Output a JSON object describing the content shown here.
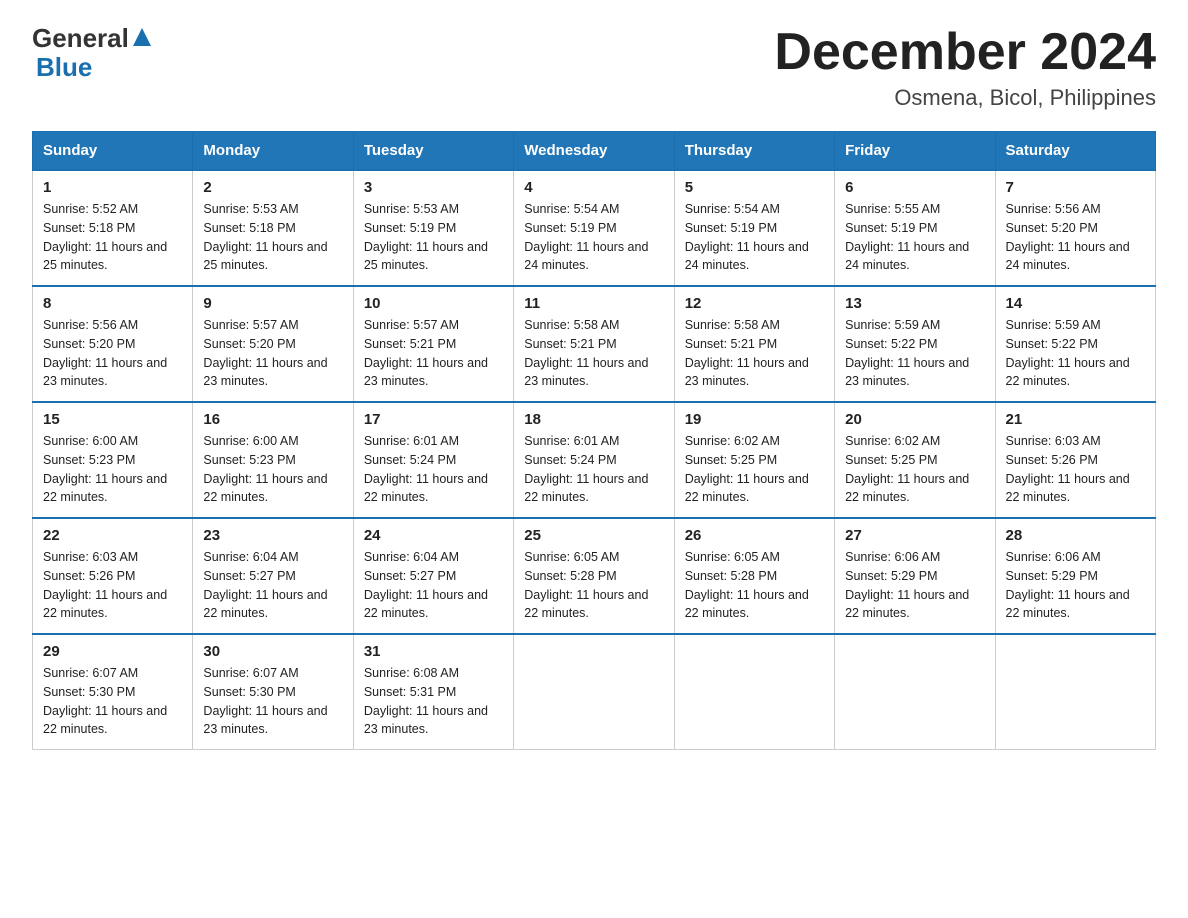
{
  "logo": {
    "general": "General",
    "blue": "Blue"
  },
  "title": "December 2024",
  "location": "Osmena, Bicol, Philippines",
  "days_of_week": [
    "Sunday",
    "Monday",
    "Tuesday",
    "Wednesday",
    "Thursday",
    "Friday",
    "Saturday"
  ],
  "weeks": [
    [
      {
        "day": "1",
        "sunrise": "Sunrise: 5:52 AM",
        "sunset": "Sunset: 5:18 PM",
        "daylight": "Daylight: 11 hours and 25 minutes."
      },
      {
        "day": "2",
        "sunrise": "Sunrise: 5:53 AM",
        "sunset": "Sunset: 5:18 PM",
        "daylight": "Daylight: 11 hours and 25 minutes."
      },
      {
        "day": "3",
        "sunrise": "Sunrise: 5:53 AM",
        "sunset": "Sunset: 5:19 PM",
        "daylight": "Daylight: 11 hours and 25 minutes."
      },
      {
        "day": "4",
        "sunrise": "Sunrise: 5:54 AM",
        "sunset": "Sunset: 5:19 PM",
        "daylight": "Daylight: 11 hours and 24 minutes."
      },
      {
        "day": "5",
        "sunrise": "Sunrise: 5:54 AM",
        "sunset": "Sunset: 5:19 PM",
        "daylight": "Daylight: 11 hours and 24 minutes."
      },
      {
        "day": "6",
        "sunrise": "Sunrise: 5:55 AM",
        "sunset": "Sunset: 5:19 PM",
        "daylight": "Daylight: 11 hours and 24 minutes."
      },
      {
        "day": "7",
        "sunrise": "Sunrise: 5:56 AM",
        "sunset": "Sunset: 5:20 PM",
        "daylight": "Daylight: 11 hours and 24 minutes."
      }
    ],
    [
      {
        "day": "8",
        "sunrise": "Sunrise: 5:56 AM",
        "sunset": "Sunset: 5:20 PM",
        "daylight": "Daylight: 11 hours and 23 minutes."
      },
      {
        "day": "9",
        "sunrise": "Sunrise: 5:57 AM",
        "sunset": "Sunset: 5:20 PM",
        "daylight": "Daylight: 11 hours and 23 minutes."
      },
      {
        "day": "10",
        "sunrise": "Sunrise: 5:57 AM",
        "sunset": "Sunset: 5:21 PM",
        "daylight": "Daylight: 11 hours and 23 minutes."
      },
      {
        "day": "11",
        "sunrise": "Sunrise: 5:58 AM",
        "sunset": "Sunset: 5:21 PM",
        "daylight": "Daylight: 11 hours and 23 minutes."
      },
      {
        "day": "12",
        "sunrise": "Sunrise: 5:58 AM",
        "sunset": "Sunset: 5:21 PM",
        "daylight": "Daylight: 11 hours and 23 minutes."
      },
      {
        "day": "13",
        "sunrise": "Sunrise: 5:59 AM",
        "sunset": "Sunset: 5:22 PM",
        "daylight": "Daylight: 11 hours and 23 minutes."
      },
      {
        "day": "14",
        "sunrise": "Sunrise: 5:59 AM",
        "sunset": "Sunset: 5:22 PM",
        "daylight": "Daylight: 11 hours and 22 minutes."
      }
    ],
    [
      {
        "day": "15",
        "sunrise": "Sunrise: 6:00 AM",
        "sunset": "Sunset: 5:23 PM",
        "daylight": "Daylight: 11 hours and 22 minutes."
      },
      {
        "day": "16",
        "sunrise": "Sunrise: 6:00 AM",
        "sunset": "Sunset: 5:23 PM",
        "daylight": "Daylight: 11 hours and 22 minutes."
      },
      {
        "day": "17",
        "sunrise": "Sunrise: 6:01 AM",
        "sunset": "Sunset: 5:24 PM",
        "daylight": "Daylight: 11 hours and 22 minutes."
      },
      {
        "day": "18",
        "sunrise": "Sunrise: 6:01 AM",
        "sunset": "Sunset: 5:24 PM",
        "daylight": "Daylight: 11 hours and 22 minutes."
      },
      {
        "day": "19",
        "sunrise": "Sunrise: 6:02 AM",
        "sunset": "Sunset: 5:25 PM",
        "daylight": "Daylight: 11 hours and 22 minutes."
      },
      {
        "day": "20",
        "sunrise": "Sunrise: 6:02 AM",
        "sunset": "Sunset: 5:25 PM",
        "daylight": "Daylight: 11 hours and 22 minutes."
      },
      {
        "day": "21",
        "sunrise": "Sunrise: 6:03 AM",
        "sunset": "Sunset: 5:26 PM",
        "daylight": "Daylight: 11 hours and 22 minutes."
      }
    ],
    [
      {
        "day": "22",
        "sunrise": "Sunrise: 6:03 AM",
        "sunset": "Sunset: 5:26 PM",
        "daylight": "Daylight: 11 hours and 22 minutes."
      },
      {
        "day": "23",
        "sunrise": "Sunrise: 6:04 AM",
        "sunset": "Sunset: 5:27 PM",
        "daylight": "Daylight: 11 hours and 22 minutes."
      },
      {
        "day": "24",
        "sunrise": "Sunrise: 6:04 AM",
        "sunset": "Sunset: 5:27 PM",
        "daylight": "Daylight: 11 hours and 22 minutes."
      },
      {
        "day": "25",
        "sunrise": "Sunrise: 6:05 AM",
        "sunset": "Sunset: 5:28 PM",
        "daylight": "Daylight: 11 hours and 22 minutes."
      },
      {
        "day": "26",
        "sunrise": "Sunrise: 6:05 AM",
        "sunset": "Sunset: 5:28 PM",
        "daylight": "Daylight: 11 hours and 22 minutes."
      },
      {
        "day": "27",
        "sunrise": "Sunrise: 6:06 AM",
        "sunset": "Sunset: 5:29 PM",
        "daylight": "Daylight: 11 hours and 22 minutes."
      },
      {
        "day": "28",
        "sunrise": "Sunrise: 6:06 AM",
        "sunset": "Sunset: 5:29 PM",
        "daylight": "Daylight: 11 hours and 22 minutes."
      }
    ],
    [
      {
        "day": "29",
        "sunrise": "Sunrise: 6:07 AM",
        "sunset": "Sunset: 5:30 PM",
        "daylight": "Daylight: 11 hours and 22 minutes."
      },
      {
        "day": "30",
        "sunrise": "Sunrise: 6:07 AM",
        "sunset": "Sunset: 5:30 PM",
        "daylight": "Daylight: 11 hours and 23 minutes."
      },
      {
        "day": "31",
        "sunrise": "Sunrise: 6:08 AM",
        "sunset": "Sunset: 5:31 PM",
        "daylight": "Daylight: 11 hours and 23 minutes."
      },
      null,
      null,
      null,
      null
    ]
  ]
}
